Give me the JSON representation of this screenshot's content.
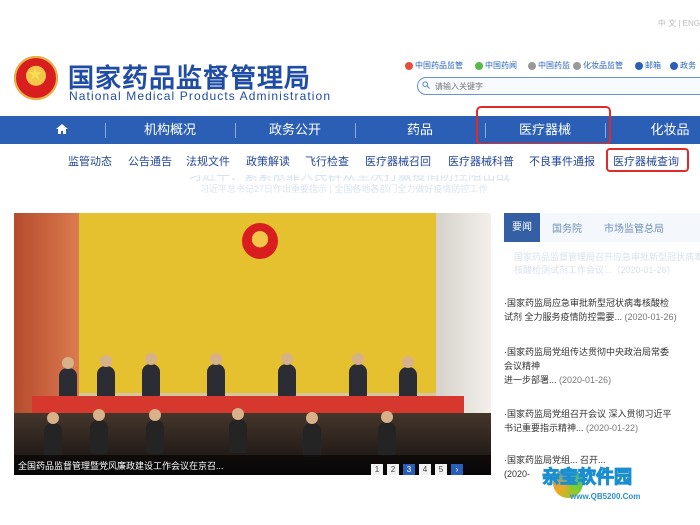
{
  "header": {
    "title_cn": "国家药品监督管理局",
    "title_en": "National Medical Products Administration",
    "top_right_fragment": "中 文 | ENG",
    "top_links": [
      "中国药品监管",
      "中国药闻",
      "中国药监",
      "化妆品监管",
      "邮箱",
      "政务"
    ],
    "search_placeholder": "请输入关键字"
  },
  "nav": {
    "items": [
      "机构概况",
      "政务公开",
      "药品",
      "医疗器械",
      "化妆品"
    ]
  },
  "subnav": {
    "items": [
      "监管动态",
      "公告通告",
      "法规文件",
      "政策解读",
      "飞行检查",
      "医疗器械召回",
      "医疗器械科普",
      "不良事件通报",
      "医疗器械查询"
    ]
  },
  "faded": {
    "headline": "习近平：紧紧依靠人民群众坚决打赢疫情防控阻击战",
    "subline": "习近平总书记27日作出重要指示 | 全国各地各部门全力做好疫情防控工作"
  },
  "banner": {
    "caption": "全国药品监督管理暨党风廉政建设工作会议在京召...",
    "pages": [
      "1",
      "2",
      "3",
      "4",
      "5"
    ],
    "next": "›"
  },
  "side": {
    "tabs": [
      "要闻",
      "国务院",
      "市场监管总局"
    ],
    "faded_lines": [
      "国家药品监督管理局召开应急审批新型冠状病毒",
      "核酸检测试剂工作会议...（2020-01-26）"
    ],
    "news": [
      {
        "title": "·国家药监局应急审批新型冠状病毒核酸检",
        "title2": "试剂 全力服务疫情防控需要...",
        "date": "(2020-01-26)"
      },
      {
        "title": "·国家药监局党组传达贯彻中央政治局常委",
        "title2": "会议精神",
        "title3": "进一步部署...",
        "date": "(2020-01-26)"
      },
      {
        "title": "·国家药监局党组召开会议 深入贯彻习近平",
        "title2": "书记重要指示精神...",
        "date": "(2020-01-22)"
      },
      {
        "title": "·国家药监局党组... 召开...",
        "title2": "(2020-",
        "date": ""
      }
    ]
  },
  "watermark": {
    "name": "亲宝软件园",
    "url": "www.QB5200.Com"
  }
}
